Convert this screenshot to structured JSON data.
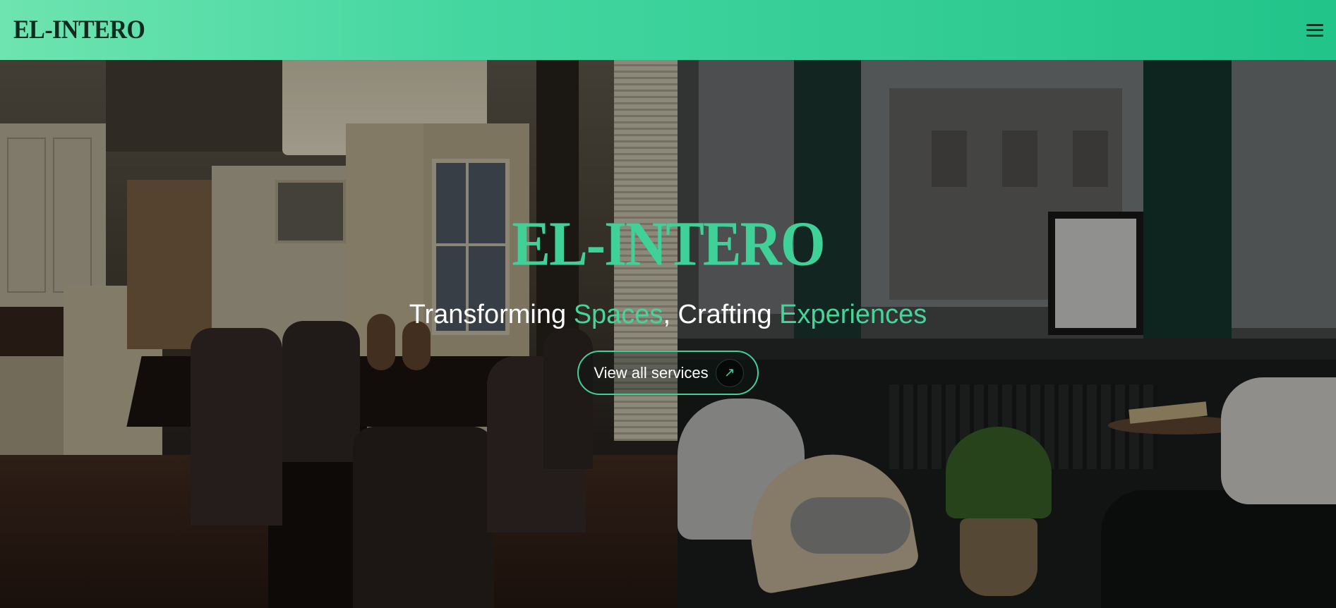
{
  "header": {
    "logo": "EL-INTERO",
    "menu_icon": "hamburger-menu-icon"
  },
  "hero": {
    "logo": "EL-INTERO",
    "tagline": {
      "part1": "Transforming ",
      "accent1": "Spaces",
      "part2": ", Crafting ",
      "accent2": "Experiences"
    },
    "cta_label": "View all services",
    "cta_icon": "arrow-up-right-icon",
    "cta_glyph": "↗"
  },
  "colors": {
    "brand_green": "#3fd197",
    "nav_gradient_start": "#6ee4b0",
    "nav_gradient_end": "#22c48a"
  }
}
